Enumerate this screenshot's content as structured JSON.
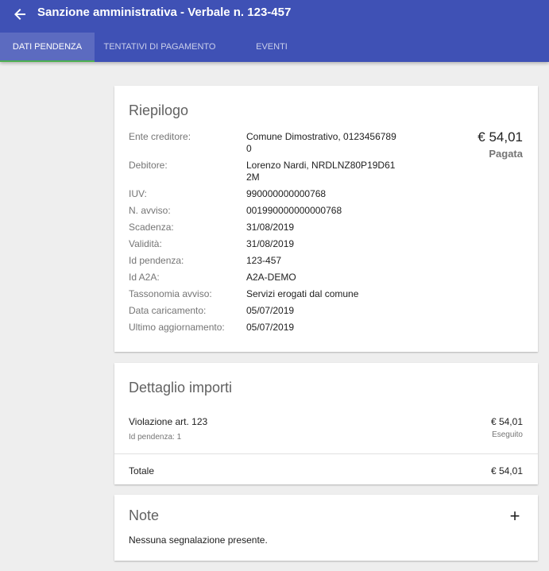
{
  "header": {
    "title": "Sanzione amministrativa - Verbale n. 123-457",
    "back_icon": "arrow-back-icon"
  },
  "tabs": [
    {
      "label": "DATI PENDENZA",
      "active": true
    },
    {
      "label": "TENTATIVI DI PAGAMENTO",
      "active": false
    },
    {
      "label": "EVENTI",
      "active": false
    }
  ],
  "colors": {
    "appbar": "#3f51b5",
    "active_tab": "#5c6bc0",
    "tab_indicator": "#4caf50",
    "background": "#eeeeee"
  },
  "riepilogo": {
    "title": "Riepilogo",
    "amount": "€ 54,01",
    "status": "Pagata",
    "fields": [
      {
        "label": "Ente creditore:",
        "value": "Comune Dimostrativo, 01234567890"
      },
      {
        "label": "Debitore:",
        "value": "Lorenzo Nardi, NRDLNZ80P19D612M"
      },
      {
        "label": "IUV:",
        "value": "990000000000768"
      },
      {
        "label": "N. avviso:",
        "value": "001990000000000768"
      },
      {
        "label": "Scadenza:",
        "value": "31/08/2019"
      },
      {
        "label": "Validità:",
        "value": "31/08/2019"
      },
      {
        "label": "Id pendenza:",
        "value": "123-457"
      },
      {
        "label": "Id A2A:",
        "value": "A2A-DEMO"
      },
      {
        "label": "Tassonomia avviso:",
        "value": "Servizi erogati dal comune"
      },
      {
        "label": "Data caricamento:",
        "value": "05/07/2019"
      },
      {
        "label": "Ultimo aggiornamento:",
        "value": "05/07/2019"
      }
    ]
  },
  "dettaglio": {
    "title": "Dettaglio importi",
    "item": {
      "name": "Violazione art. 123",
      "sub": "Id pendenza: 1",
      "amount": "€ 54,01",
      "state": "Eseguito"
    },
    "total_label": "Totale",
    "total_amount": "€ 54,01"
  },
  "note": {
    "title": "Note",
    "add_label": "+",
    "text": "Nessuna segnalazione presente."
  }
}
